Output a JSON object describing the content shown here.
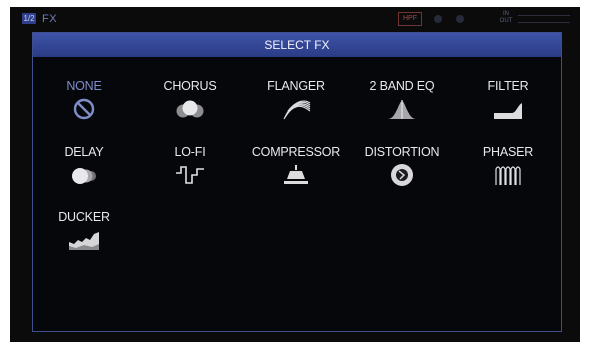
{
  "window": {
    "channel_badge": "1/2",
    "title": "FX",
    "hpf_label": "HPF",
    "inout_label": "IN OUT"
  },
  "dialog": {
    "title": "SELECT FX"
  },
  "effects": [
    {
      "label": "NONE",
      "icon": "none-icon",
      "selected": false
    },
    {
      "label": "CHORUS",
      "icon": "chorus-icon"
    },
    {
      "label": "FLANGER",
      "icon": "flanger-icon"
    },
    {
      "label": "2 BAND EQ",
      "icon": "eq-icon"
    },
    {
      "label": "FILTER",
      "icon": "filter-icon"
    },
    {
      "label": "DELAY",
      "icon": "delay-icon"
    },
    {
      "label": "LO-FI",
      "icon": "lofi-icon"
    },
    {
      "label": "COMPRESSOR",
      "icon": "compressor-icon"
    },
    {
      "label": "DISTORTION",
      "icon": "distortion-icon"
    },
    {
      "label": "PHASER",
      "icon": "phaser-icon"
    },
    {
      "label": "DUCKER",
      "icon": "ducker-icon"
    }
  ],
  "colors": {
    "accent": "#2f43a0",
    "dim_label": "#7f8eca",
    "text": "#e9e9ec"
  }
}
